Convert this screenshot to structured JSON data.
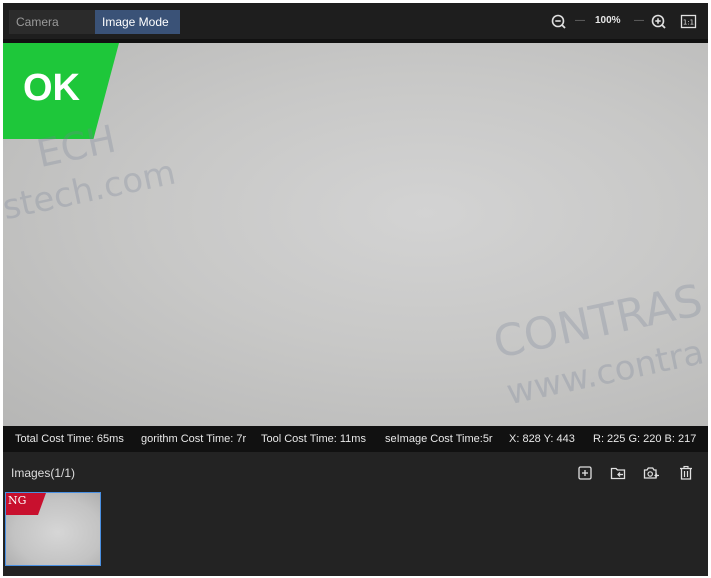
{
  "toolbar": {
    "tabs": [
      {
        "label": "Camera Mode",
        "active": false
      },
      {
        "label": "Image Mode",
        "active": true
      }
    ],
    "zoom_level": "100%",
    "icons": [
      "zoom-out-icon",
      "zoom-in-icon",
      "actual-size-icon"
    ],
    "actual_size_label": "1:1"
  },
  "canvas": {
    "result": "OK",
    "result_color": "#1ec73a",
    "watermarks": [
      "ECH",
      "stech.com",
      "CONTRAS",
      "www.contra"
    ]
  },
  "status_bar": {
    "total_cost": "Total Cost Time: 65ms",
    "algorithm_cost": "gorithm Cost Time: 7r",
    "tool_cost": "Tool Cost Time: 11ms",
    "image_cost": "seImage Cost Time:5r",
    "coords": "X: 828 Y: 443",
    "rgb": "R: 225 G: 220 B: 217"
  },
  "images_panel": {
    "title": "Images(1/1)",
    "icons": [
      "add-image-icon",
      "import-folder-icon",
      "capture-icon",
      "delete-icon"
    ],
    "thumbnails": [
      {
        "result": "NG",
        "result_color": "#c8102e",
        "selected": true
      }
    ]
  },
  "colors": {
    "active_tab": "#3a5277",
    "selection_border": "#4a90e2"
  }
}
